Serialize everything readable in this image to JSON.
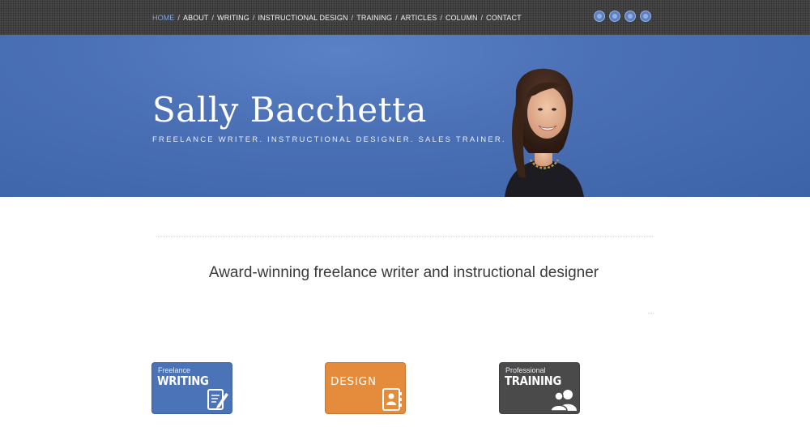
{
  "nav": {
    "items": [
      {
        "label": "Home",
        "active": true
      },
      {
        "label": "About"
      },
      {
        "label": "Writing"
      },
      {
        "label": "Instructional Design"
      },
      {
        "label": "Training"
      },
      {
        "label": "Articles"
      },
      {
        "label": "Column"
      },
      {
        "label": "Contact"
      }
    ],
    "separator": "/",
    "social_icons": [
      "linkedin-icon",
      "twitter-icon",
      "rss-icon",
      "email-icon"
    ]
  },
  "header": {
    "title": "Sally Bacchetta",
    "tagline": "Freelance Writer. Instructional Designer. Sales Trainer."
  },
  "main": {
    "headline": "Award-winning freelance writer and instructional designer"
  },
  "tiles": [
    {
      "small": "Freelance",
      "big": "WRITING",
      "icon": "document-pen-icon",
      "color": "#4b74b8"
    },
    {
      "small": "",
      "big": "DESIGN",
      "icon": "address-book-icon",
      "color": "#e58c3c"
    },
    {
      "small": "Professional",
      "big": "TRAINING",
      "icon": "people-icon",
      "color": "#4a4a4a"
    }
  ],
  "colors": {
    "topbar": "#4a4a4a",
    "banner": "#4b70b6",
    "nav_active": "#7fa6e0"
  }
}
